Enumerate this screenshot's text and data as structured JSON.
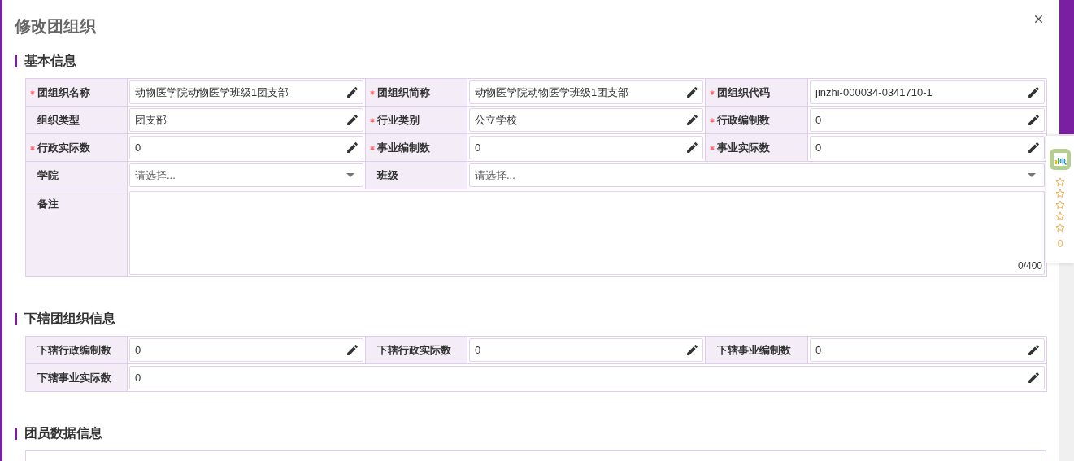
{
  "dialog": {
    "title": "修改团组织"
  },
  "sections": [
    {
      "title": "基本信息",
      "fields": [
        {
          "label": "团组织名称",
          "required": true,
          "kind": "text",
          "value": "动物医学院动物医学班级1团支部",
          "wide": false
        },
        {
          "label": "团组织简称",
          "required": true,
          "kind": "text",
          "value": "动物医学院动物医学班级1团支部",
          "wide": false
        },
        {
          "label": "团组织代码",
          "required": true,
          "kind": "text",
          "value": "jinzhi-000034-0341710-1",
          "wide": false
        },
        {
          "label": "组织类型",
          "required": false,
          "kind": "text",
          "value": "团支部",
          "wide": false
        },
        {
          "label": "行业类别",
          "required": true,
          "kind": "text",
          "value": "公立学校",
          "wide": false
        },
        {
          "label": "行政编制数",
          "required": true,
          "kind": "text",
          "value": "0",
          "wide": false
        },
        {
          "label": "行政实际数",
          "required": true,
          "kind": "text",
          "value": "0",
          "wide": false
        },
        {
          "label": "事业编制数",
          "required": true,
          "kind": "text",
          "value": "0",
          "wide": false
        },
        {
          "label": "事业实际数",
          "required": true,
          "kind": "text",
          "value": "0",
          "wide": false
        },
        {
          "label": "学院",
          "required": false,
          "kind": "select",
          "placeholder": "请选择...",
          "wide": false
        },
        {
          "label": "班级",
          "required": false,
          "kind": "select",
          "placeholder": "请选择...",
          "wide": true
        },
        {
          "label": "备注",
          "required": false,
          "kind": "textarea",
          "counter": "0/400",
          "wide": true
        }
      ]
    },
    {
      "title": "下辖团组织信息",
      "fields": [
        {
          "label": "下辖行政编制数",
          "required": false,
          "kind": "text",
          "value": "0",
          "wide": false
        },
        {
          "label": "下辖行政实际数",
          "required": false,
          "kind": "text",
          "value": "0",
          "wide": false
        },
        {
          "label": "下辖事业编制数",
          "required": false,
          "kind": "text",
          "value": "0",
          "wide": false
        },
        {
          "label": "下辖事业实际数",
          "required": false,
          "kind": "text",
          "value": "0",
          "wide": true
        }
      ]
    },
    {
      "title": "团员数据信息"
    }
  ],
  "side_widget": {
    "count": "0"
  }
}
